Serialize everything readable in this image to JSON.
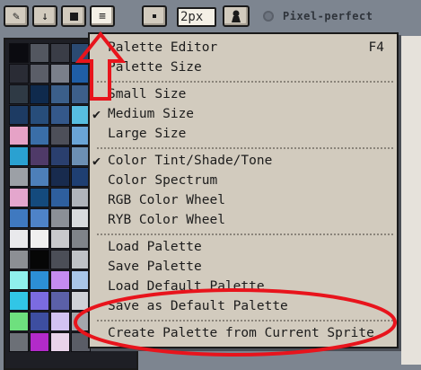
{
  "toolbar": {
    "buttons": [
      {
        "name": "pencil-icon",
        "glyph": "✎"
      },
      {
        "name": "arrow-down-icon",
        "glyph": "↓"
      },
      {
        "name": "stop-square-icon",
        "glyph": ""
      },
      {
        "name": "menu-icon",
        "glyph": "≡"
      }
    ],
    "brush_type_icon": "dot-icon",
    "brush_size_value": "2px",
    "shade_icon": "pawn-icon",
    "pixel_perfect_label": "Pixel-perfect",
    "pixel_perfect_checked": false
  },
  "palette": {
    "colors": [
      "#0b0b10",
      "#535760",
      "#3a3d47",
      "#2b4a72",
      "#2a2c35",
      "#5b5e68",
      "#7a7f8a",
      "#1f5ea6",
      "#2f3a45",
      "#0f2a4d",
      "#3b5f8a",
      "#3d5f8a",
      "#1d3b63",
      "#274d7a",
      "#34588a",
      "#57bde0",
      "#e6a2c6",
      "#3a6ea8",
      "#4d4f59",
      "#6aa4d6",
      "#2aa1d1",
      "#4f3a68",
      "#2a3f6e",
      "#6c8fb3",
      "#9ca0a6",
      "#4d7fb9",
      "#182b4e",
      "#1f3f72",
      "#e4a6cd",
      "#144a7d",
      "#2e5f9e",
      "#b0b4bb",
      "#3f79c0",
      "#4e83c8",
      "#8b8f97",
      "#d8dadd",
      "#e9e9ec",
      "#f0f0f0",
      "#c9c9cc",
      "#7f8389",
      "#8c8f94",
      "#060606",
      "#4b4e57",
      "#bfc2c7",
      "#8ff0ec",
      "#2c8fd6",
      "#c58bf0",
      "#a9c6e8",
      "#31c6e6",
      "#7b6be0",
      "#5b60a8",
      "#d0d2d6",
      "#6ee07e",
      "#3d4ea0",
      "#d2c2f2",
      "#a3a6ac",
      "#6c7077",
      "#b22ac9",
      "#e9d3ea",
      "#5a5d66"
    ]
  },
  "menu": {
    "items": [
      {
        "label": "Palette Editor",
        "shortcut": "F4",
        "checked": false
      },
      {
        "label": "Palette Size",
        "shortcut": "",
        "checked": false
      },
      {
        "label": "Small Size",
        "shortcut": "",
        "checked": false
      },
      {
        "label": "Medium Size",
        "shortcut": "",
        "checked": true
      },
      {
        "label": "Large Size",
        "shortcut": "",
        "checked": false
      },
      {
        "label": "Color Tint/Shade/Tone",
        "shortcut": "",
        "checked": true
      },
      {
        "label": "Color Spectrum",
        "shortcut": "",
        "checked": false
      },
      {
        "label": "RGB Color Wheel",
        "shortcut": "",
        "checked": false
      },
      {
        "label": "RYB Color Wheel",
        "shortcut": "",
        "checked": false
      },
      {
        "label": "Load Palette",
        "shortcut": "",
        "checked": false
      },
      {
        "label": "Save Palette",
        "shortcut": "",
        "checked": false
      },
      {
        "label": "Load Default Palette",
        "shortcut": "",
        "checked": false
      },
      {
        "label": "Save as Default Palette",
        "shortcut": "",
        "checked": false
      },
      {
        "label": "Create Palette from Current Sprite",
        "shortcut": "",
        "checked": false
      }
    ],
    "check_glyph": "✔"
  },
  "annotations": {
    "arrow_color": "#e8141c",
    "ellipse_color": "#e8141c"
  }
}
